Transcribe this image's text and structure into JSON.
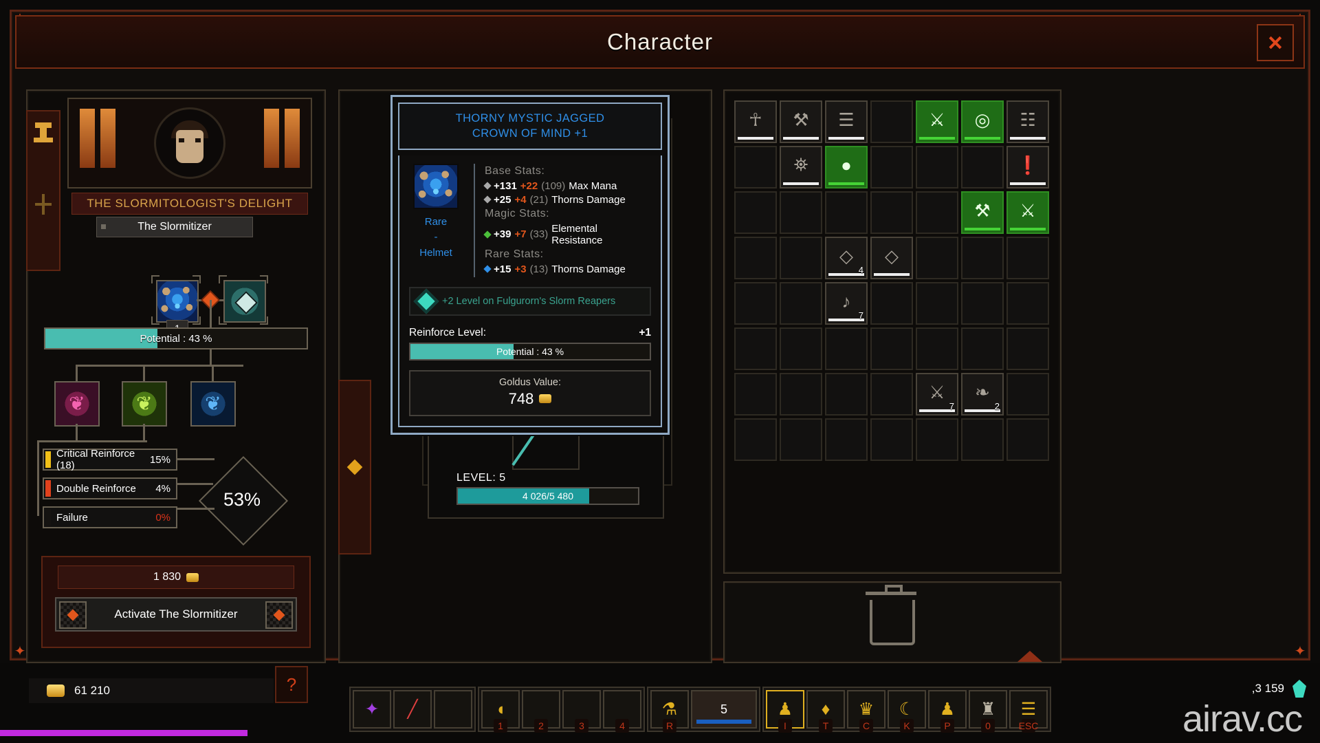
{
  "window": {
    "title": "Character",
    "close_label": "close-window"
  },
  "slormitizer": {
    "banner_title": "THE SLORMITOLOGIST'S DELIGHT",
    "subtitle": "The Slormitizer",
    "input_item_qty": "1",
    "potential": {
      "label": "Potential : 43 %",
      "percent": 43
    },
    "runes": [
      {
        "name": "rune-pink",
        "glyph": "❦",
        "color": "#e84fa0"
      },
      {
        "name": "rune-green",
        "glyph": "❦",
        "color": "#c2e84f"
      },
      {
        "name": "rune-blue",
        "glyph": "❦",
        "color": "#4fa8e8"
      }
    ],
    "stat_rows": [
      {
        "label": "Critical Reinforce (18)",
        "value": "15%",
        "marker_color": "#f2c017",
        "value_color": "#ffffff"
      },
      {
        "label": "Double Reinforce",
        "value": "4%",
        "marker_color": "#e2411c",
        "value_color": "#ffffff"
      },
      {
        "label": "Failure",
        "value": "0%",
        "marker_color": "#151311",
        "value_color": "#d8331a"
      }
    ],
    "total_percent": "53%",
    "cost": "1 830",
    "activate_label": "Activate The Slormitizer"
  },
  "tooltip": {
    "title_line1": "THORNY MYSTIC JAGGED",
    "title_line2": "CROWN OF MIND +1",
    "rarity": "Rare",
    "dash": "-",
    "slot_type": "Helmet",
    "sections": [
      {
        "heading": "Base Stats:",
        "lines": [
          {
            "bullet": "grey",
            "num": "+131",
            "plus": "+22",
            "paren": "(109)",
            "text": "Max Mana"
          },
          {
            "bullet": "grey",
            "num": "+25",
            "plus": "+4",
            "paren": "(21)",
            "text": "Thorns Damage"
          }
        ]
      },
      {
        "heading": "Magic Stats:",
        "lines": [
          {
            "bullet": "green",
            "num": "+39",
            "plus": "+7",
            "paren": "(33)",
            "text": "Elemental Resistance"
          }
        ]
      },
      {
        "heading": "Rare Stats:",
        "lines": [
          {
            "bullet": "blue",
            "num": "+15",
            "plus": "+3",
            "paren": "(13)",
            "text": "Thorns Damage"
          }
        ]
      }
    ],
    "legend_text": "+2 Level on Fulgurorn's Slorm Reapers",
    "reinforce_label": "Reinforce Level:",
    "reinforce_value": "+1",
    "potential": {
      "label": "Potential : 43 %",
      "percent": 43
    },
    "goldus_label": "Goldus Value:",
    "goldus_value": "748"
  },
  "character": {
    "level_label": "LEVEL: 5",
    "xp_bar": {
      "label": "4 026/5 480",
      "percent": 73
    },
    "equipment": [
      {
        "name": "amulet-slot",
        "rarity": "green",
        "glyph": "◈"
      },
      {
        "name": "body-armor-slot",
        "rarity": "normal",
        "glyph": "⛊"
      },
      {
        "name": "shoulder-slot",
        "rarity": "normal",
        "glyph": "⸻"
      },
      {
        "name": "belt-slot",
        "rarity": "normal",
        "glyph": "⚙"
      },
      {
        "name": "ring-slot",
        "rarity": "normal",
        "glyph": "◎"
      }
    ]
  },
  "inventory": {
    "cells": [
      {
        "row": 0,
        "col": 0,
        "state": "filled",
        "rarity": "normal",
        "glyph": "☥",
        "count": ""
      },
      {
        "row": 0,
        "col": 1,
        "state": "filled",
        "rarity": "normal",
        "glyph": "⚒",
        "count": ""
      },
      {
        "row": 0,
        "col": 2,
        "state": "filled",
        "rarity": "normal",
        "glyph": "☰",
        "count": ""
      },
      {
        "row": 0,
        "col": 3,
        "state": "empty",
        "rarity": "",
        "glyph": "",
        "count": ""
      },
      {
        "row": 0,
        "col": 4,
        "state": "filled",
        "rarity": "rare",
        "glyph": "⚔",
        "count": ""
      },
      {
        "row": 0,
        "col": 5,
        "state": "filled",
        "rarity": "rare",
        "glyph": "◎",
        "count": ""
      },
      {
        "row": 0,
        "col": 6,
        "state": "filled",
        "rarity": "normal",
        "glyph": "☷",
        "count": ""
      },
      {
        "row": 0,
        "col": 7,
        "state": "filled",
        "rarity": "rare",
        "glyph": "☠",
        "count": ""
      },
      {
        "row": 1,
        "col": 0,
        "state": "empty",
        "rarity": "",
        "glyph": "",
        "count": ""
      },
      {
        "row": 1,
        "col": 1,
        "state": "filled",
        "rarity": "normal",
        "glyph": "⛯",
        "count": ""
      },
      {
        "row": 1,
        "col": 2,
        "state": "filled",
        "rarity": "rare",
        "glyph": "●",
        "count": ""
      },
      {
        "row": 1,
        "col": 6,
        "state": "filled",
        "rarity": "normal",
        "glyph": "❗",
        "count": ""
      },
      {
        "row": 2,
        "col": 5,
        "state": "filled",
        "rarity": "rare",
        "glyph": "⚒",
        "count": ""
      },
      {
        "row": 2,
        "col": 6,
        "state": "filled",
        "rarity": "rare",
        "glyph": "⚔",
        "count": ""
      },
      {
        "row": 3,
        "col": 2,
        "state": "filled",
        "rarity": "normal",
        "glyph": "◇",
        "count": "4"
      },
      {
        "row": 3,
        "col": 3,
        "state": "filled",
        "rarity": "normal",
        "glyph": "◇",
        "count": ""
      },
      {
        "row": 4,
        "col": 2,
        "state": "filled",
        "rarity": "normal",
        "glyph": "♪",
        "count": "7"
      },
      {
        "row": 6,
        "col": 4,
        "state": "filled",
        "rarity": "normal",
        "glyph": "⚔",
        "count": "7"
      },
      {
        "row": 6,
        "col": 5,
        "state": "filled",
        "rarity": "normal",
        "glyph": "❧",
        "count": "2"
      }
    ],
    "rows": 8,
    "cols": 7
  },
  "hud": {
    "gold": "61 210",
    "crystals": ",3 159",
    "help_glyph": "?",
    "skills": [
      {
        "key": "",
        "name": "skill-purple",
        "glyph": "✦",
        "color": "#a23fe0"
      },
      {
        "key": "",
        "name": "skill-red",
        "glyph": "╱",
        "color": "#e03f3f"
      },
      {
        "key": "",
        "name": "skill-empty",
        "glyph": "",
        "color": "#2a2520"
      }
    ],
    "ultimates": [
      {
        "key": "1",
        "name": "ult-1",
        "glyph": "◖",
        "color": "#e0b020"
      },
      {
        "key": "2",
        "name": "ult-2",
        "glyph": "",
        "color": "#221d18"
      },
      {
        "key": "3",
        "name": "ult-3",
        "glyph": "",
        "color": "#221d18"
      },
      {
        "key": "4",
        "name": "ult-4",
        "glyph": "",
        "color": "#221d18"
      }
    ],
    "potion": {
      "key": "R",
      "count": "5",
      "name": "potion-slot"
    },
    "menus": [
      {
        "key": "I",
        "name": "inventory-button",
        "glyph": "♟",
        "color": "#e0b020",
        "active": true
      },
      {
        "key": "T",
        "name": "skilltree-button",
        "glyph": "♦",
        "color": "#e0b020",
        "active": false
      },
      {
        "key": "C",
        "name": "character-button",
        "glyph": "♛",
        "color": "#e0b020",
        "active": false
      },
      {
        "key": "K",
        "name": "reapers-button",
        "glyph": "☾",
        "color": "#e0b020",
        "active": false
      },
      {
        "key": "P",
        "name": "profile-button",
        "glyph": "♟",
        "color": "#e0b020",
        "active": false
      },
      {
        "key": "0",
        "name": "trophies-button",
        "glyph": "♜",
        "color": "#bdb6a6",
        "active": false
      },
      {
        "key": "ESC",
        "name": "menu-button",
        "glyph": "☰",
        "color": "#e0b020",
        "active": false
      }
    ]
  },
  "watermark": "airav.cc"
}
